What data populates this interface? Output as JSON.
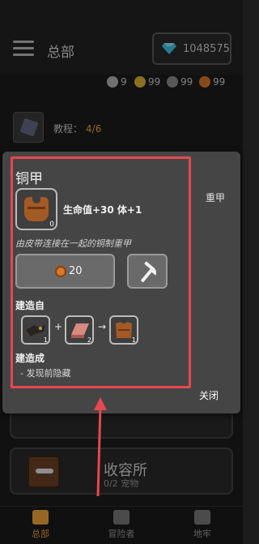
{
  "header": {
    "title": "总部",
    "gems": "1048575"
  },
  "resources": [
    {
      "icon": "silver-coin-icon",
      "value": "9",
      "color": "#b5b5b5"
    },
    {
      "icon": "gold-coin-icon",
      "value": "99",
      "color": "#e0b534"
    },
    {
      "icon": "grey-coin-icon",
      "value": "99",
      "color": "#8f8f8f"
    },
    {
      "icon": "copper-coin-icon",
      "value": "99",
      "color": "#d9782a"
    }
  ],
  "tutorial": {
    "label": "教程：",
    "progress": "4/6"
  },
  "shelter": {
    "title": "收容所",
    "subtitle": "0/2 宠物"
  },
  "tabs": [
    {
      "label": "总部",
      "icon": "castle-icon"
    },
    {
      "label": "冒险者",
      "icon": "people-icon"
    },
    {
      "label": "地牢",
      "icon": "gate-icon"
    }
  ],
  "modal": {
    "title": "铜甲",
    "side_label": "重甲",
    "item_qty": "0",
    "stats": "生命值+30 体+1",
    "description": "由皮带连接在一起的铜制重甲",
    "cost": "20",
    "build_from_label": "建造自",
    "recipe": [
      {
        "name": "leather-straps",
        "qty": "1"
      },
      {
        "name": "copper-ingot",
        "qty": "2"
      }
    ],
    "plus_sign": "+",
    "arrow_sign": "→",
    "result_qty": "1",
    "builds_into_label": "建造成",
    "builds_into_value": "- 发现前隐藏",
    "close_label": "关闭"
  }
}
